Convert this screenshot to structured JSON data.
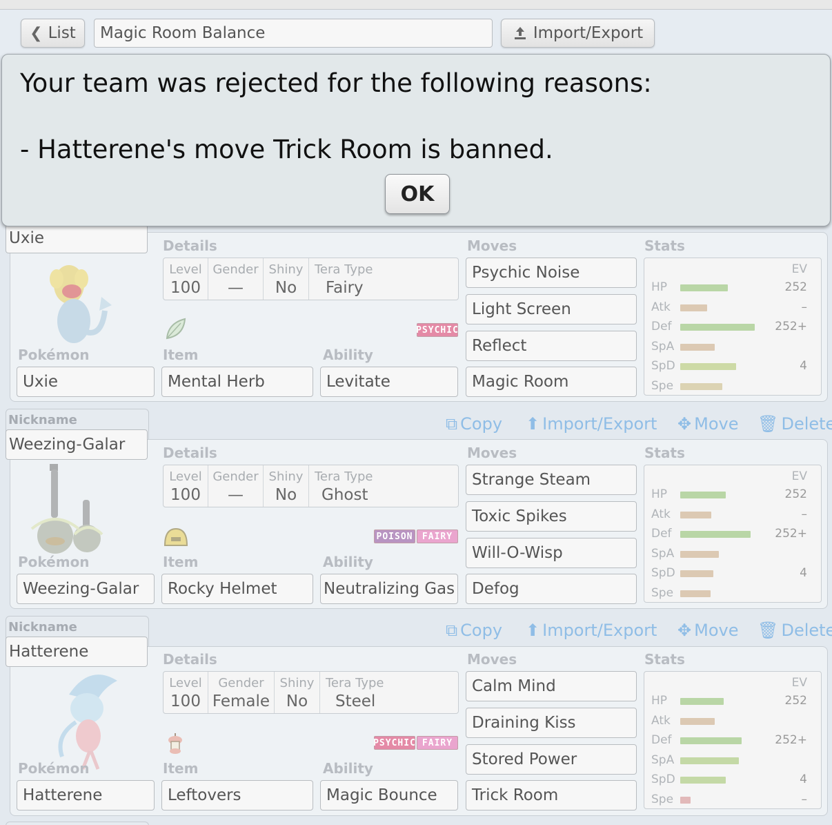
{
  "teambar": {
    "list_label": "List",
    "team_name": "Magic Room Balance",
    "import_export_label": "Import/Export"
  },
  "dialog": {
    "line1": "Your team was rejected for the following reasons:",
    "line2": "- Hatterene's move Trick Room is banned.",
    "ok_label": "OK"
  },
  "labels": {
    "nickname": "Nickname",
    "details": "Details",
    "moves": "Moves",
    "stats": "Stats",
    "pokemon": "Pokémon",
    "item": "Item",
    "ability": "Ability",
    "level": "Level",
    "gender": "Gender",
    "shiny": "Shiny",
    "tera_type": "Tera Type",
    "ev": "EV",
    "copy": "Copy",
    "import_export": "Import/Export",
    "move": "Move",
    "delete": "Delete"
  },
  "sets": [
    {
      "nickname": "Uxie",
      "species": "Uxie",
      "level": "100",
      "gender": "—",
      "shiny": "No",
      "tera_type": "Fairy",
      "item": "Mental Herb",
      "ability": "Levitate",
      "types": [
        "PSYCHIC"
      ],
      "moves": [
        "Psychic Noise",
        "Light Screen",
        "Reflect",
        "Magic Room"
      ],
      "stats": [
        {
          "name": "HP",
          "ev": "252",
          "bar": 0.46,
          "color": "#b9d6a6"
        },
        {
          "name": "Atk",
          "ev": "–",
          "bar": 0.26,
          "color": "#dcc9b3"
        },
        {
          "name": "Def",
          "ev": "252+",
          "bar": 0.72,
          "color": "#b9d6a6"
        },
        {
          "name": "SpA",
          "ev": "",
          "bar": 0.33,
          "color": "#dcc9b3"
        },
        {
          "name": "SpD",
          "ev": "4",
          "bar": 0.54,
          "color": "#cddaa6"
        },
        {
          "name": "Spe",
          "ev": "",
          "bar": 0.41,
          "color": "#dcd3b3"
        }
      ]
    },
    {
      "nickname": "Weezing-Galar",
      "species": "Weezing-Galar",
      "level": "100",
      "gender": "—",
      "shiny": "No",
      "tera_type": "Ghost",
      "item": "Rocky Helmet",
      "ability": "Neutralizing Gas",
      "types": [
        "POISON",
        "FAIRY"
      ],
      "moves": [
        "Strange Steam",
        "Toxic Spikes",
        "Will-O-Wisp",
        "Defog"
      ],
      "stats": [
        {
          "name": "HP",
          "ev": "252",
          "bar": 0.44,
          "color": "#b9d6a6"
        },
        {
          "name": "Atk",
          "ev": "–",
          "bar": 0.3,
          "color": "#dcc9b3"
        },
        {
          "name": "Def",
          "ev": "252+",
          "bar": 0.68,
          "color": "#b9d6a6"
        },
        {
          "name": "SpA",
          "ev": "",
          "bar": 0.37,
          "color": "#dcc9b3"
        },
        {
          "name": "SpD",
          "ev": "4",
          "bar": 0.32,
          "color": "#dcc9b3"
        },
        {
          "name": "Spe",
          "ev": "",
          "bar": 0.29,
          "color": "#dcc9b3"
        }
      ]
    },
    {
      "nickname": "Hatterene",
      "species": "Hatterene",
      "level": "100",
      "gender": "Female",
      "shiny": "No",
      "tera_type": "Steel",
      "item": "Leftovers",
      "ability": "Magic Bounce",
      "types": [
        "PSYCHIC",
        "FAIRY"
      ],
      "moves": [
        "Calm Mind",
        "Draining Kiss",
        "Stored Power",
        "Trick Room"
      ],
      "stats": [
        {
          "name": "HP",
          "ev": "252",
          "bar": 0.42,
          "color": "#b9d6a6"
        },
        {
          "name": "Atk",
          "ev": "",
          "bar": 0.33,
          "color": "#dcc9b3"
        },
        {
          "name": "Def",
          "ev": "252+",
          "bar": 0.59,
          "color": "#b9d6a6"
        },
        {
          "name": "SpA",
          "ev": "",
          "bar": 0.57,
          "color": "#c4d9a6"
        },
        {
          "name": "SpD",
          "ev": "4",
          "bar": 0.44,
          "color": "#c4d9a6"
        },
        {
          "name": "Spe",
          "ev": "–",
          "bar": 0.1,
          "color": "#e2b9b9"
        }
      ]
    }
  ],
  "colors": {
    "psychic": "#e48aa6",
    "poison": "#b894c2",
    "fairy": "#eaa5ce",
    "action": "#8fbde6"
  }
}
